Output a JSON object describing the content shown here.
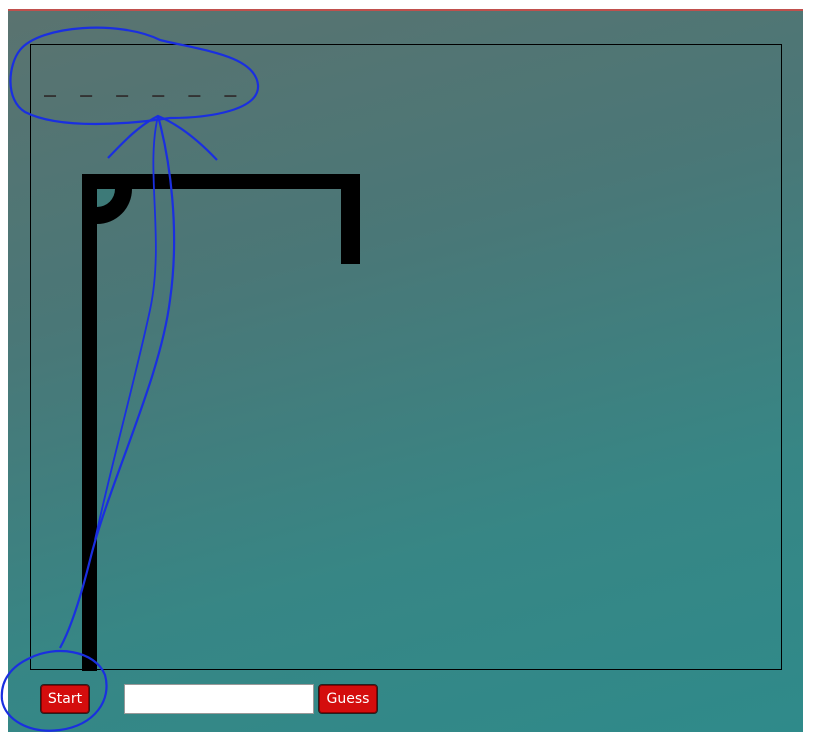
{
  "game": {
    "word_mask": "_ _ _ _ _ _",
    "guess_input_value": "",
    "guess_input_placeholder": ""
  },
  "controls": {
    "start_label": "Start",
    "guess_label": "Guess"
  },
  "colors": {
    "button_bg": "#d40d0d",
    "gallows": "#000000",
    "annotation_ink": "#1a2fe0",
    "background_top": "#5a7370",
    "background_bottom": "#2f8a8a"
  },
  "icons": {
    "annotation": "hand-drawn-arrow-annotation"
  }
}
